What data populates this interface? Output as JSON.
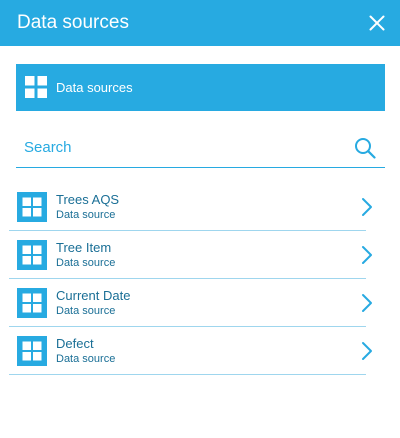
{
  "header": {
    "title": "Data sources",
    "close_icon": "close-icon"
  },
  "data_sources_bar": {
    "label": "Data sources",
    "icon": "grid-icon"
  },
  "search": {
    "value": "",
    "placeholder": "Search",
    "icon": "search-icon"
  },
  "items": [
    {
      "name": "Trees AQS",
      "type": "Data source",
      "icon": "grid-icon",
      "action_icon": "chevron-right-icon"
    },
    {
      "name": "Tree Item",
      "type": "Data source",
      "icon": "grid-icon",
      "action_icon": "chevron-right-icon"
    },
    {
      "name": "Current Date",
      "type": "Data source",
      "icon": "grid-icon",
      "action_icon": "chevron-right-icon"
    },
    {
      "name": "Defect",
      "type": "Data source",
      "icon": "grid-icon",
      "action_icon": "chevron-right-icon"
    }
  ],
  "colors": {
    "accent": "#27aae1",
    "text": "#1a6f96",
    "divider": "#9fd6ee",
    "background": "#ffffff"
  }
}
